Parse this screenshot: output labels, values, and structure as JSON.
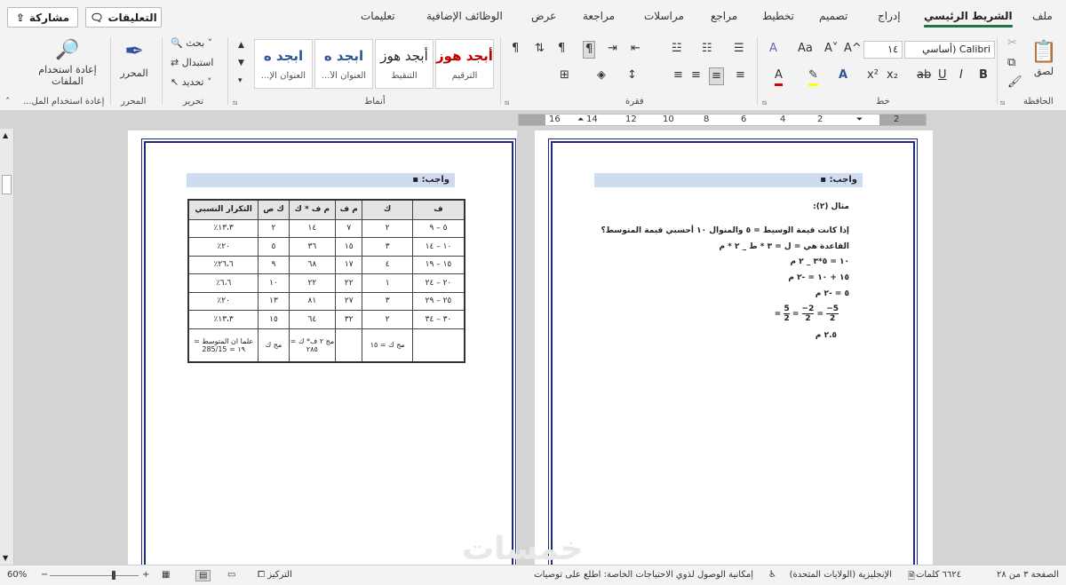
{
  "tabs": [
    "ملف",
    "الشريط الرئيسي",
    "إدراج",
    "تصميم",
    "تخطيط",
    "مراجع",
    "مراسلات",
    "مراجعة",
    "عرض",
    "الوظائف الإضافية",
    "تعليمات"
  ],
  "active_tab": "الشريط الرئيسي",
  "top_buttons": {
    "comments": "التعليقات",
    "share": "مشاركة"
  },
  "clipboard": {
    "paste": "لصق",
    "group": "الحافظة"
  },
  "font": {
    "name": "Calibri (أساسي",
    "size": "١٤",
    "group": "خط",
    "bold": "B",
    "italic": "I",
    "underline": "U",
    "subscript": "x₂",
    "superscript": "x²",
    "grow": "A^",
    "shrink": "A˅",
    "case": "Aa"
  },
  "paragraph": {
    "group": "فقرة"
  },
  "styles": {
    "group": "أنماط",
    "items": [
      {
        "sample": "أبجد هوز",
        "name": "الترقيم",
        "color": "#c00000"
      },
      {
        "sample": "أبجد هوز",
        "name": "التنقيط",
        "color": "#222222"
      },
      {
        "sample": "ابجد ه",
        "name": "العنوان الأ...",
        "color": "#2f5597"
      },
      {
        "sample": "ابجد ه",
        "name": "العنوان الإ...",
        "color": "#2f5597"
      }
    ]
  },
  "editing": {
    "find": "بحث",
    "replace": "استبدال",
    "select": "تحديد",
    "group": "تحرير"
  },
  "editor": {
    "label": "المحرر",
    "group": "المحرر"
  },
  "reuse": {
    "label1": "إعادة استخدام",
    "label2": "الملفات",
    "group": "إعادة استخدام المل..."
  },
  "ruler": {
    "numbers": [
      "2",
      "2",
      "4",
      "6",
      "8",
      "10",
      "12",
      "14",
      "16"
    ]
  },
  "right_page": {
    "heading": "واجب:",
    "example": "مثال (٢):",
    "lines": [
      "إذا كانت قيمة الوسيط = ٥ والمنوال ١٠ أحسبي قيمة المتوسط؟",
      "القاعدة هي = ل = ٣ * ط _ ٢ * م",
      "١٠ = ٥*٣ _ ٢ م",
      "١٥ + ١٠ = -٢ م",
      "٥ = -٢ م",
      "٢.٥ م"
    ],
    "fractions": [
      "5",
      "2",
      "=",
      "2−",
      "2",
      "=",
      "5−",
      "2",
      "="
    ]
  },
  "left_page": {
    "heading": "واجب:",
    "table": {
      "headers": [
        "ف",
        "ك",
        "م ف",
        "م ف * ك",
        "ك ص",
        "التكرار النسبي"
      ],
      "rows": [
        [
          "٥ – ٩",
          "٢",
          "٧",
          "١٤",
          "٢",
          "١٣،٣٪"
        ],
        [
          "١٠ – ١٤",
          "٣",
          "١٥",
          "٣٦",
          "٥",
          "٢٠٪"
        ],
        [
          "١٥ – ١٩",
          "٤",
          "١٧",
          "٦٨",
          "٩",
          "٢٦،٦٪"
        ],
        [
          "٢٠ – ٢٤",
          "١",
          "٢٢",
          "٢٢",
          "١٠",
          "٦،٦٪"
        ],
        [
          "٢٥ – ٢٩",
          "٣",
          "٢٧",
          "٨١",
          "١٣",
          "٢٠٪"
        ],
        [
          "٣٠ – ٣٤",
          "٢",
          "٣٢",
          "٦٤",
          "١٥",
          "١٣،٣٪"
        ]
      ],
      "footer": [
        "",
        "مج ك = ١٥",
        "",
        "مج ٢ ف* ك = ٢٨٥",
        "مج ك",
        "علما ان المتوسط = ١٩ = 285/15"
      ]
    }
  },
  "status": {
    "page": "الصفحة ٣ من ٢٨",
    "words": "٦٦٢٤ كلمات",
    "language": "الإنجليزية (الولايات المتحدة)",
    "accessibility": "إمكانية الوصول لذوي الاحتياجات الخاصة: اطلع على توصيات",
    "focus": "التركيز",
    "zoom": "60%"
  },
  "watermark": "خمسات"
}
